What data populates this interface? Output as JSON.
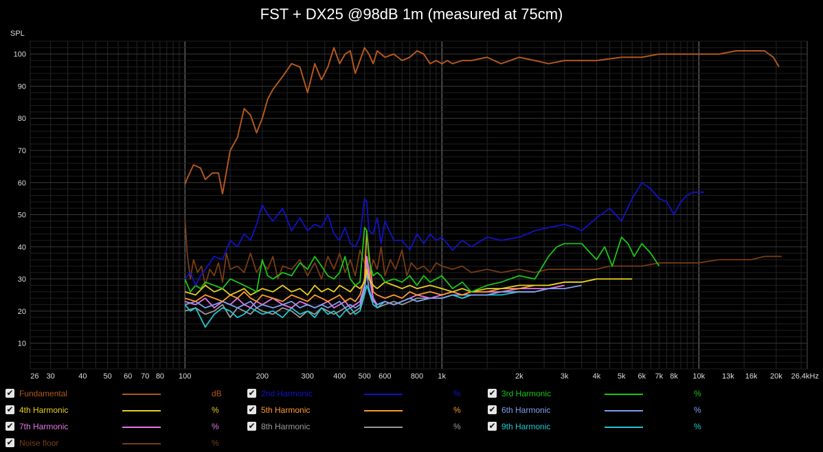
{
  "chart_data": {
    "type": "line",
    "title": "FST + DX25 @98dB 1m (measured at 75cm)",
    "ylabel": "SPL",
    "xlabel": "",
    "x_scale": "log",
    "xlim": [
      25,
      26400
    ],
    "ylim": [
      2,
      104
    ],
    "grid": true,
    "legend_position": "bottom",
    "xtick_labels": [
      {
        "x": 26,
        "label": "26"
      },
      {
        "x": 30,
        "label": "30"
      },
      {
        "x": 40,
        "label": "40"
      },
      {
        "x": 50,
        "label": "50"
      },
      {
        "x": 60,
        "label": "60"
      },
      {
        "x": 70,
        "label": "70"
      },
      {
        "x": 80,
        "label": "80"
      },
      {
        "x": 100,
        "label": "100"
      },
      {
        "x": 200,
        "label": "200"
      },
      {
        "x": 300,
        "label": "300"
      },
      {
        "x": 400,
        "label": "400"
      },
      {
        "x": 500,
        "label": "500"
      },
      {
        "x": 600,
        "label": "600"
      },
      {
        "x": 800,
        "label": "800"
      },
      {
        "x": 1000,
        "label": "1k"
      },
      {
        "x": 2000,
        "label": "2k"
      },
      {
        "x": 3000,
        "label": "3k"
      },
      {
        "x": 4000,
        "label": "4k"
      },
      {
        "x": 5000,
        "label": "5k"
      },
      {
        "x": 6000,
        "label": "6k"
      },
      {
        "x": 7000,
        "label": "7k"
      },
      {
        "x": 8000,
        "label": "8k"
      },
      {
        "x": 10000,
        "label": "10k"
      },
      {
        "x": 13000,
        "label": "13k"
      },
      {
        "x": 16000,
        "label": "16k"
      },
      {
        "x": 20000,
        "label": "20k"
      },
      {
        "x": 26400,
        "label": "26.4kHz"
      }
    ],
    "yticks": [
      10,
      20,
      30,
      40,
      50,
      60,
      70,
      80,
      90,
      100
    ],
    "series": [
      {
        "name": "Fundamental",
        "unit": "dB",
        "color": "#b5581e",
        "x": [
          100,
          103,
          108,
          115,
          120,
          128,
          135,
          140,
          150,
          160,
          170,
          180,
          190,
          200,
          210,
          220,
          240,
          260,
          280,
          300,
          320,
          340,
          360,
          380,
          400,
          420,
          440,
          460,
          480,
          500,
          520,
          540,
          560,
          600,
          650,
          700,
          750,
          800,
          850,
          900,
          950,
          1000,
          1050,
          1100,
          1200,
          1300,
          1500,
          1700,
          2000,
          2300,
          2600,
          3000,
          3500,
          4000,
          5000,
          6000,
          7000,
          8000,
          10000,
          12000,
          14000,
          16000,
          18000,
          19500,
          20500
        ],
        "y": [
          59.5,
          62,
          65.5,
          64.5,
          61,
          63,
          63,
          56.5,
          70,
          74,
          83,
          81,
          75.5,
          80,
          86,
          89,
          93,
          97,
          96,
          88,
          97,
          92,
          96,
          102,
          97,
          100,
          101,
          94,
          98,
          102,
          100,
          97,
          101,
          99,
          100,
          98,
          99,
          101,
          100,
          97,
          98,
          97,
          98,
          97,
          98,
          98,
          99,
          97,
          99,
          98,
          97,
          98,
          98,
          98,
          99,
          99,
          100,
          100,
          100,
          100,
          101,
          101,
          101,
          99,
          96
        ]
      },
      {
        "name": "2nd Harmonic",
        "unit": "%",
        "color": "#1212c8",
        "x": [
          100,
          105,
          110,
          115,
          120,
          130,
          140,
          150,
          160,
          170,
          180,
          190,
          200,
          210,
          220,
          240,
          260,
          280,
          300,
          320,
          340,
          360,
          380,
          400,
          420,
          440,
          460,
          480,
          500,
          510,
          520,
          540,
          560,
          580,
          600,
          650,
          700,
          750,
          800,
          850,
          900,
          950,
          1000,
          1100,
          1200,
          1300,
          1500,
          1700,
          2000,
          2300,
          2600,
          3000,
          3300,
          3500,
          4000,
          4500,
          5000,
          5500,
          6000,
          6500,
          7000,
          7500,
          8000,
          8500,
          9000,
          9500,
          10000,
          10500
        ],
        "y": [
          30,
          32,
          28,
          31,
          33,
          37,
          36,
          42,
          40,
          44,
          42,
          47,
          53,
          50,
          48,
          52,
          45,
          49,
          45,
          47,
          46,
          50,
          44,
          42,
          46,
          41,
          40,
          43,
          55,
          54,
          45,
          44,
          49,
          41,
          48,
          42,
          42,
          39,
          44,
          41,
          44,
          42,
          43,
          39,
          42,
          40,
          43,
          42,
          43,
          45,
          46,
          47,
          46,
          45,
          49,
          52,
          48,
          55,
          60,
          58,
          55,
          54,
          50,
          54,
          56,
          57,
          57,
          57
        ]
      },
      {
        "name": "3rd Harmonic",
        "unit": "%",
        "color": "#18c818",
        "x": [
          100,
          105,
          110,
          115,
          120,
          130,
          140,
          150,
          160,
          170,
          180,
          190,
          200,
          210,
          220,
          240,
          260,
          280,
          300,
          320,
          340,
          360,
          380,
          400,
          420,
          440,
          460,
          480,
          500,
          510,
          520,
          540,
          560,
          580,
          600,
          650,
          700,
          750,
          800,
          850,
          900,
          950,
          1000,
          1100,
          1200,
          1300,
          1500,
          1700,
          2000,
          2300,
          2600,
          2800,
          3000,
          3500,
          4000,
          4300,
          4600,
          5000,
          5300,
          5600,
          6000,
          6500,
          7000
        ],
        "y": [
          30,
          26,
          28,
          27,
          29,
          28,
          27,
          30,
          29,
          28,
          27,
          26,
          36,
          31,
          30,
          32,
          31,
          35,
          33,
          37,
          34,
          31,
          30,
          32,
          37,
          30,
          28,
          29,
          46,
          45,
          36,
          31,
          32,
          31,
          29,
          30,
          29,
          31,
          28,
          31,
          29,
          30,
          31,
          27,
          29,
          26,
          28,
          29,
          31,
          30,
          37,
          40,
          41,
          41,
          36,
          40,
          34,
          43,
          41,
          37,
          41,
          38,
          34
        ]
      },
      {
        "name": "4th Harmonic",
        "unit": "%",
        "color": "#e8d020",
        "x": [
          100,
          110,
          120,
          130,
          140,
          150,
          160,
          170,
          180,
          190,
          200,
          220,
          240,
          260,
          280,
          300,
          320,
          340,
          360,
          380,
          400,
          420,
          440,
          460,
          480,
          500,
          510,
          520,
          540,
          560,
          600,
          650,
          700,
          750,
          800,
          900,
          1000,
          1100,
          1200,
          1300,
          1500,
          1700,
          2000,
          2300,
          2600,
          3000,
          3500,
          4000,
          4500,
          5000,
          5500
        ],
        "y": [
          26,
          25,
          28,
          26,
          27,
          25,
          26,
          27,
          25,
          26,
          27,
          26,
          28,
          26,
          27,
          25,
          28,
          26,
          27,
          26,
          28,
          27,
          26,
          28,
          27,
          29,
          33,
          30,
          28,
          27,
          29,
          28,
          27,
          28,
          27,
          28,
          27,
          26,
          27,
          26,
          27,
          27,
          28,
          28,
          28,
          29,
          29,
          30,
          30,
          30,
          30
        ]
      },
      {
        "name": "5th Harmonic",
        "unit": "%",
        "color": "#ff9a30",
        "x": [
          100,
          110,
          120,
          130,
          140,
          150,
          160,
          170,
          180,
          190,
          200,
          220,
          240,
          260,
          280,
          300,
          320,
          340,
          360,
          380,
          400,
          420,
          440,
          460,
          480,
          500,
          510,
          520,
          540,
          560,
          600,
          650,
          700,
          750,
          800,
          900,
          1000,
          1100,
          1200,
          1300,
          1500,
          1700,
          2000,
          2300,
          2600,
          3000,
          3500,
          4000
        ],
        "y": [
          24,
          23,
          25,
          24,
          23,
          25,
          24,
          26,
          24,
          23,
          25,
          24,
          23,
          25,
          24,
          23,
          25,
          24,
          23,
          24,
          25,
          23,
          24,
          23,
          25,
          30,
          45,
          38,
          26,
          25,
          24,
          25,
          24,
          26,
          25,
          26,
          25,
          26,
          25,
          26,
          26,
          27,
          27,
          28,
          28,
          29,
          29,
          30
        ]
      },
      {
        "name": "6th Harmonic",
        "unit": "%",
        "color": "#7fa0f0",
        "x": [
          100,
          110,
          120,
          130,
          140,
          150,
          160,
          170,
          180,
          190,
          200,
          220,
          240,
          260,
          280,
          300,
          320,
          340,
          360,
          380,
          400,
          420,
          440,
          460,
          480,
          500,
          510,
          520,
          540,
          560,
          600,
          650,
          700,
          750,
          800,
          900,
          1000,
          1100,
          1200,
          1300,
          1500,
          1700,
          2000,
          2300,
          2600,
          3000,
          3500
        ],
        "y": [
          22,
          23,
          21,
          22,
          23,
          22,
          21,
          22,
          23,
          21,
          22,
          21,
          22,
          23,
          21,
          22,
          21,
          22,
          21,
          22,
          23,
          21,
          22,
          21,
          22,
          27,
          32,
          27,
          23,
          22,
          23,
          22,
          23,
          24,
          23,
          24,
          24,
          25,
          25,
          25,
          25,
          26,
          26,
          26,
          27,
          27,
          28
        ]
      },
      {
        "name": "7th Harmonic",
        "unit": "%",
        "color": "#e878e8",
        "x": [
          100,
          110,
          120,
          130,
          140,
          150,
          160,
          170,
          180,
          190,
          200,
          220,
          240,
          260,
          280,
          300,
          320,
          340,
          360,
          380,
          400,
          420,
          440,
          460,
          480,
          500,
          510,
          520,
          540,
          560,
          600,
          650,
          700,
          750,
          800,
          900,
          1000,
          1100,
          1200,
          1300,
          1500,
          1700,
          2000,
          2300,
          2600,
          3000
        ],
        "y": [
          23,
          22,
          24,
          21,
          23,
          22,
          24,
          22,
          21,
          23,
          22,
          24,
          22,
          21,
          23,
          22,
          21,
          22,
          23,
          21,
          22,
          23,
          21,
          22,
          23,
          28,
          37,
          33,
          24,
          22,
          23,
          22,
          23,
          24,
          25,
          24,
          25,
          26,
          25,
          26,
          26,
          26,
          27,
          27,
          27,
          28
        ]
      },
      {
        "name": "8th Harmonic",
        "unit": "%",
        "color": "#9a9a9a",
        "x": [
          100,
          110,
          120,
          130,
          140,
          150,
          160,
          170,
          180,
          190,
          200,
          220,
          240,
          260,
          280,
          300,
          320,
          340,
          360,
          380,
          400,
          420,
          440,
          460,
          480,
          500,
          510,
          520,
          540,
          560,
          600,
          650,
          700,
          750,
          800,
          900,
          1000,
          1100,
          1200,
          1300,
          1500,
          1700,
          2000,
          2300,
          2600
        ],
        "y": [
          20,
          21,
          19,
          20,
          22,
          18,
          21,
          20,
          19,
          21,
          20,
          19,
          21,
          20,
          18,
          20,
          19,
          21,
          20,
          19,
          20,
          21,
          19,
          20,
          21,
          26,
          35,
          31,
          24,
          21,
          22,
          23,
          22,
          23,
          24,
          24,
          24,
          25,
          24,
          25,
          25,
          26,
          26,
          26,
          27
        ]
      },
      {
        "name": "9th Harmonic",
        "unit": "%",
        "color": "#20c8d0",
        "x": [
          100,
          105,
          110,
          115,
          120,
          130,
          140,
          150,
          160,
          170,
          180,
          190,
          200,
          220,
          240,
          260,
          280,
          300,
          320,
          340,
          360,
          380,
          400,
          420,
          440,
          460,
          480,
          500,
          510,
          520,
          540,
          560,
          600,
          650,
          700,
          750,
          800,
          900,
          1000,
          1100,
          1200,
          1300,
          1500,
          1700,
          2000,
          2300
        ],
        "y": [
          22,
          20,
          21,
          18,
          15,
          19,
          21,
          20,
          18,
          19,
          21,
          20,
          19,
          20,
          18,
          21,
          19,
          20,
          18,
          21,
          19,
          20,
          18,
          20,
          21,
          19,
          20,
          25,
          28,
          26,
          22,
          21,
          23,
          22,
          23,
          24,
          23,
          24,
          24,
          25,
          24,
          25,
          25,
          25,
          26,
          26
        ]
      },
      {
        "name": "Noise floor",
        "unit": "%",
        "color": "#7a3c14",
        "x": [
          100,
          102,
          105,
          108,
          112,
          116,
          120,
          125,
          130,
          135,
          140,
          145,
          150,
          160,
          170,
          180,
          190,
          200,
          210,
          220,
          230,
          240,
          260,
          280,
          300,
          320,
          340,
          360,
          380,
          400,
          420,
          440,
          460,
          480,
          500,
          520,
          540,
          560,
          580,
          600,
          630,
          660,
          700,
          730,
          760,
          800,
          850,
          900,
          950,
          1000,
          1100,
          1200,
          1300,
          1500,
          1700,
          2000,
          2300,
          2600,
          3000,
          3500,
          4000,
          4500,
          5000,
          6000,
          7000,
          8000,
          10000,
          12000,
          14000,
          16000,
          18000,
          20000,
          21000
        ],
        "y": [
          49,
          38,
          30,
          36,
          32,
          34,
          28,
          33,
          31,
          35,
          29,
          38,
          33,
          34,
          32,
          38,
          32,
          35,
          33,
          37,
          30,
          34,
          33,
          36,
          31,
          35,
          30,
          37,
          33,
          38,
          32,
          36,
          31,
          39,
          35,
          30,
          36,
          33,
          40,
          31,
          36,
          33,
          39,
          31,
          35,
          33,
          34,
          32,
          35,
          34,
          33,
          34,
          32,
          33,
          32,
          33,
          32,
          33,
          33,
          33,
          33,
          34,
          34,
          34,
          35,
          35,
          35,
          36,
          36,
          36,
          37,
          37,
          37
        ]
      }
    ]
  }
}
